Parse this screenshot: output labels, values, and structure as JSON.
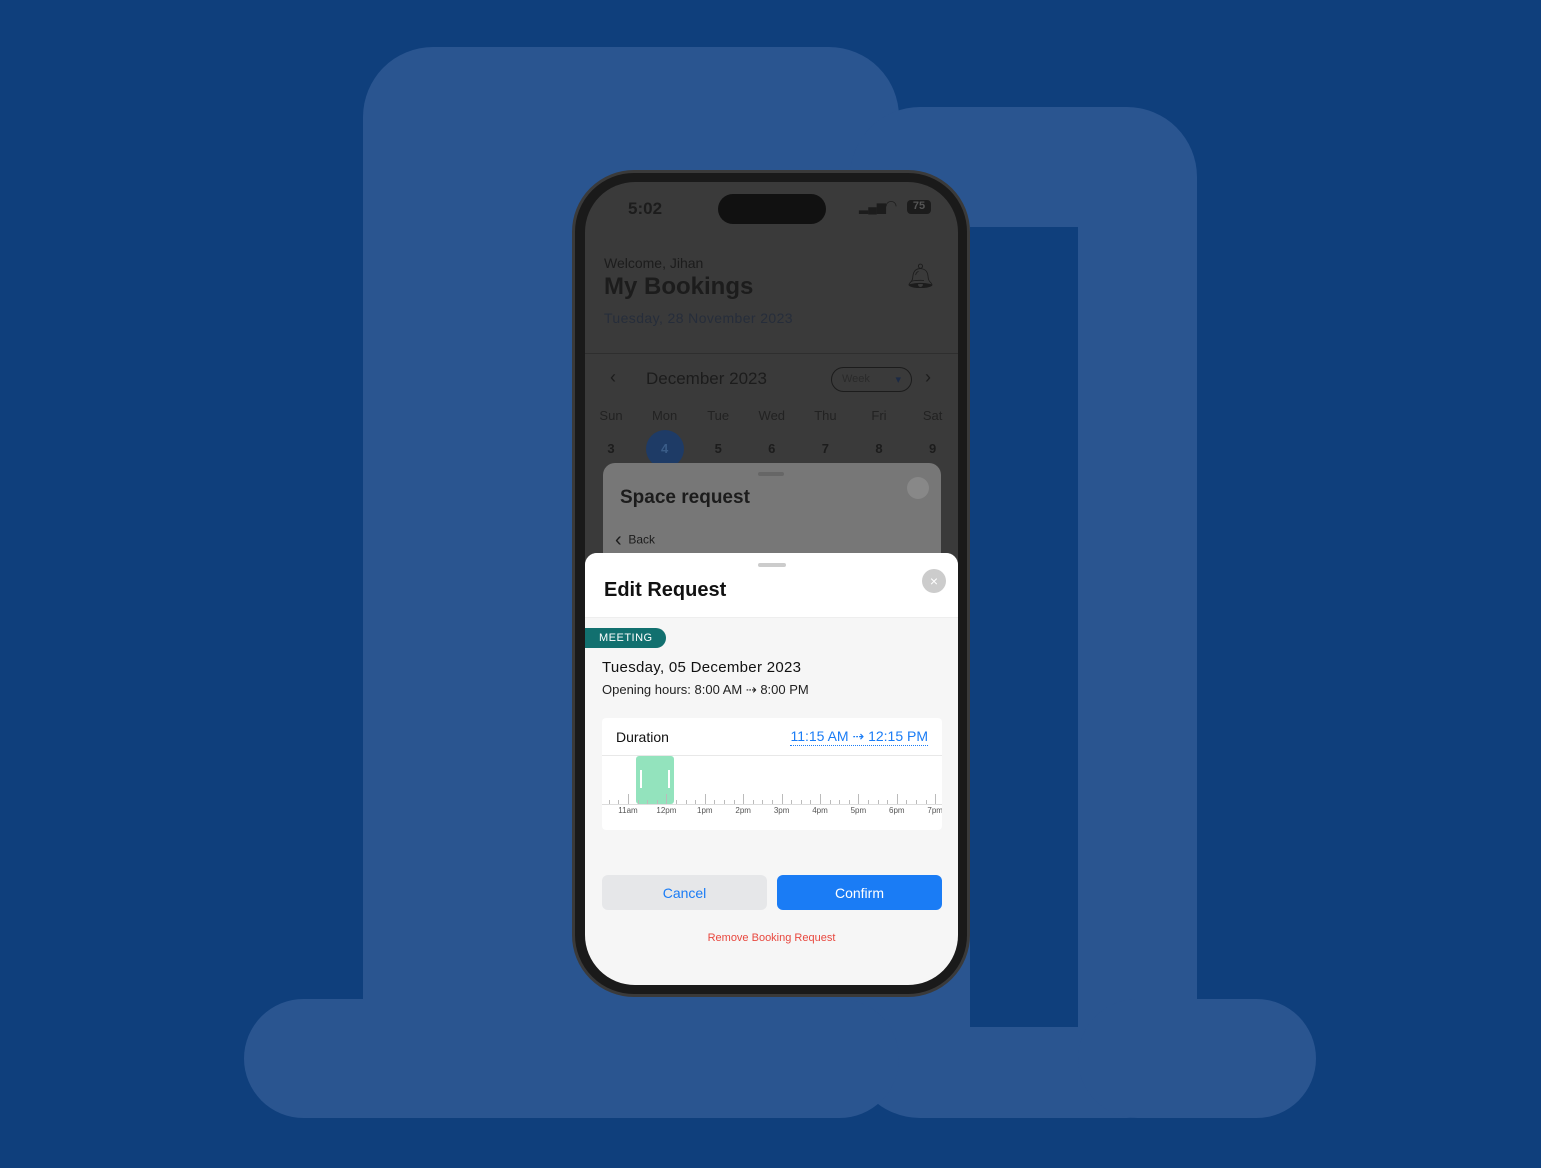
{
  "status": {
    "time": "5:02",
    "battery": "75"
  },
  "header": {
    "welcome": "Welcome, Jihan",
    "title": "My Bookings",
    "date": "Tuesday, 28 November 2023"
  },
  "calendar": {
    "month": "December 2023",
    "view": "Week",
    "days": [
      {
        "d": "Sun",
        "n": "3"
      },
      {
        "d": "Mon",
        "n": "4"
      },
      {
        "d": "Tue",
        "n": "5"
      },
      {
        "d": "Wed",
        "n": "6"
      },
      {
        "d": "Thu",
        "n": "7"
      },
      {
        "d": "Fri",
        "n": "8"
      },
      {
        "d": "Sat",
        "n": "9"
      }
    ],
    "selected": "4"
  },
  "space_request": {
    "title": "Space request",
    "back": "Back"
  },
  "edit": {
    "title": "Edit Request",
    "badge": "MEETING",
    "date": "Tuesday, 05 December 2023",
    "hours": "Opening hours: 8:00 AM ⇢ 8:00 PM",
    "duration_label": "Duration",
    "duration_value": "11:15 AM ⇢ 12:15 PM",
    "timeline": {
      "labels": [
        "11am",
        "12pm",
        "1pm",
        "2pm",
        "3pm",
        "4pm",
        "5pm",
        "6pm",
        "7pm"
      ],
      "start": "11:15",
      "end": "12:15"
    },
    "cancel": "Cancel",
    "confirm": "Confirm",
    "remove": "Remove Booking Request"
  },
  "colors": {
    "accent": "#1a7cf5",
    "badge": "#12706f",
    "selection": "#93e3bd",
    "danger": "#e8483f"
  }
}
